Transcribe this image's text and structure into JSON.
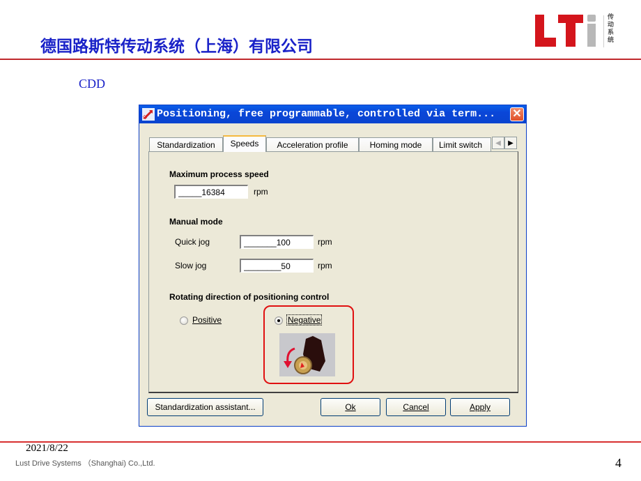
{
  "slide": {
    "title": "德国路斯特传动系统（上海）有限公司",
    "logo_text": "LTi",
    "logo_subtitle": "传动系统",
    "section": "CDD",
    "date": "2021/8/22",
    "company": "Lust Drive Systems （Shanghai) Co.,Ltd.",
    "page_number": "4"
  },
  "dialog": {
    "title": "Positioning, free programmable, controlled via term...",
    "close_icon": "close-icon",
    "tabs": [
      {
        "label": "Standardization",
        "active": false
      },
      {
        "label": "Speeds",
        "active": true
      },
      {
        "label": "Acceleration profile",
        "active": false
      },
      {
        "label": "Homing mode",
        "active": false
      },
      {
        "label": "Limit switch",
        "active": false
      }
    ],
    "tab_scroll_left": "◀",
    "tab_scroll_right": "▶",
    "max_speed": {
      "heading": "Maximum process speed",
      "value": "_____16384",
      "unit": "rpm"
    },
    "manual_mode": {
      "heading": "Manual mode",
      "quick_jog_label": "Quick jog",
      "quick_jog_value": "_______100",
      "quick_jog_unit": "rpm",
      "slow_jog_label": "Slow jog",
      "slow_jog_value": "________50",
      "slow_jog_unit": "rpm"
    },
    "rotation": {
      "heading": "Rotating direction of positioning control",
      "positive_label": "Positive",
      "negative_label": "Negative",
      "selected": "Negative"
    },
    "buttons": {
      "assistant": "Standardization assistant...",
      "ok": "Ok",
      "cancel": "Cancel",
      "apply": "Apply"
    }
  }
}
